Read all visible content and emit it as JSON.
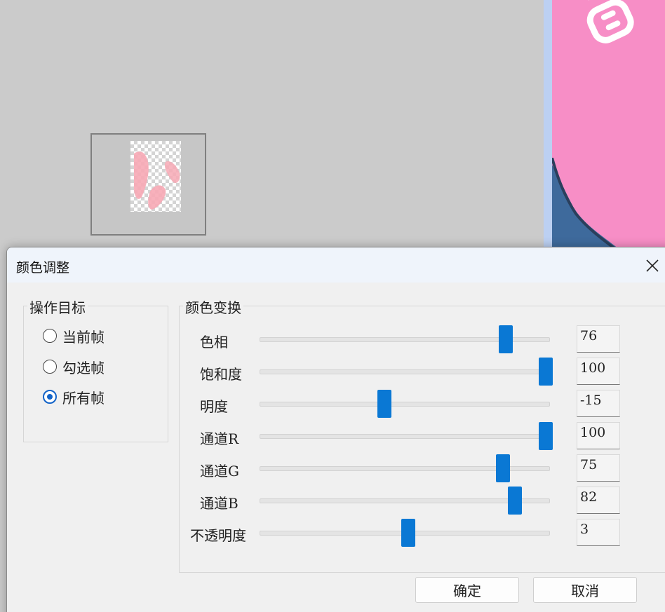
{
  "dialog": {
    "title": "颜色调整",
    "target_group": {
      "title": "操作目标",
      "options": [
        {
          "label": "当前帧",
          "checked": false
        },
        {
          "label": "勾选帧",
          "checked": false
        },
        {
          "label": "所有帧",
          "checked": true
        }
      ]
    },
    "transform_group": {
      "title": "颜色变换",
      "sliders": [
        {
          "label": "色相",
          "value": "76",
          "level": 0.86
        },
        {
          "label": "饱和度",
          "value": "100",
          "level": 1.0
        },
        {
          "label": "明度",
          "value": "-15",
          "level": 0.43
        },
        {
          "label": "通道R",
          "value": "100",
          "level": 1.0
        },
        {
          "label": "通道G",
          "value": "75",
          "level": 0.85
        },
        {
          "label": "通道B",
          "value": "82",
          "level": 0.89
        },
        {
          "label": "不透明度",
          "value": "3",
          "level": 0.515
        }
      ]
    },
    "ok_label": "确定",
    "cancel_label": "取消"
  },
  "colors": {
    "accent": "#0a78d4",
    "preview_bg": "#f78ec6",
    "side_strip": "#bcd0f2"
  }
}
